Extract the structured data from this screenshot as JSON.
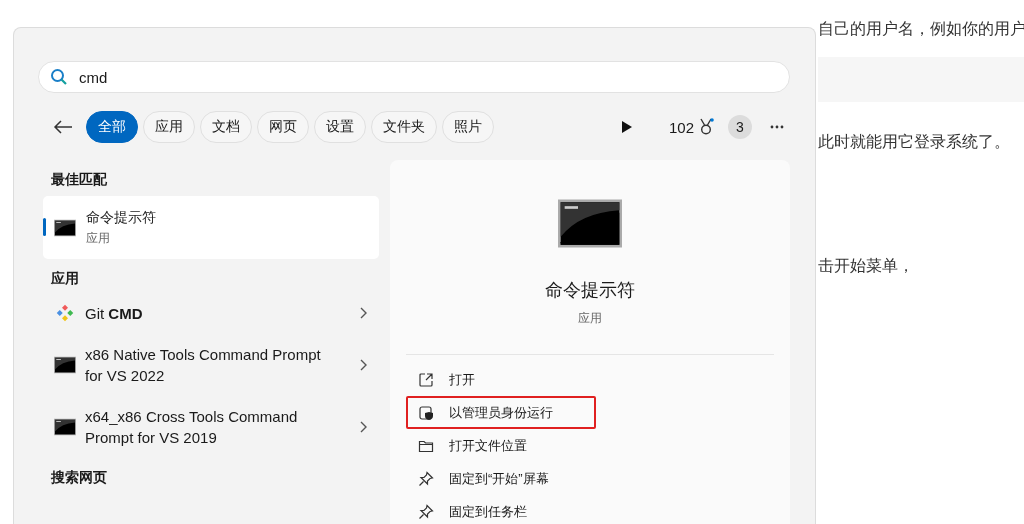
{
  "search": {
    "value": "cmd"
  },
  "filters": [
    {
      "label": "全部",
      "selected": true
    },
    {
      "label": "应用",
      "selected": false
    },
    {
      "label": "文档",
      "selected": false
    },
    {
      "label": "网页",
      "selected": false
    },
    {
      "label": "设置",
      "selected": false
    },
    {
      "label": "文件夹",
      "selected": false
    },
    {
      "label": "照片",
      "selected": false
    }
  ],
  "toolbar": {
    "points": "102",
    "badge": "3"
  },
  "best_match": {
    "heading": "最佳匹配",
    "title": "命令提示符",
    "subtitle": "应用",
    "selected": true
  },
  "apps": {
    "heading": "应用",
    "items": [
      {
        "title": "Git **CMD**",
        "kind": "git"
      },
      {
        "title": "x86 Native Tools Command Prompt for VS 2022",
        "kind": "console"
      },
      {
        "title": "x64_x86 Cross Tools Command Prompt for VS 2019",
        "kind": "console"
      }
    ]
  },
  "search_web": {
    "heading": "搜索网页"
  },
  "detail": {
    "title": "命令提示符",
    "subtitle": "应用",
    "actions": [
      {
        "label": "打开",
        "kind": "open",
        "highlighted": false
      },
      {
        "label": "以管理员身份运行",
        "kind": "admin",
        "highlighted": true
      },
      {
        "label": "打开文件位置",
        "kind": "folder",
        "highlighted": false
      },
      {
        "label": "固定到“开始”屏幕",
        "kind": "pin",
        "highlighted": false
      },
      {
        "label": "固定到任务栏",
        "kind": "pin",
        "highlighted": false
      }
    ]
  },
  "article": {
    "lines": [
      "自己的用户名，例如你的用户",
      "此时就能用它登录系统了。",
      "击开始菜单，"
    ]
  }
}
